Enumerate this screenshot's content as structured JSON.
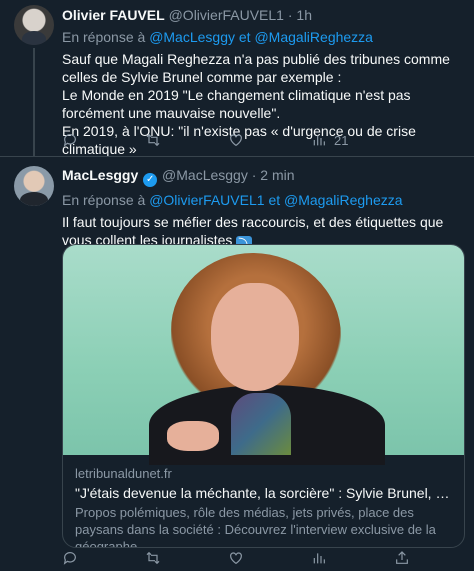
{
  "tweets": [
    {
      "name": "Olivier FAUVEL",
      "handle": "@OlivierFAUVEL1",
      "time": "1h",
      "reply_prefix": "En réponse à",
      "reply_to": [
        "@MacLesggy",
        "@MagaliReghezza"
      ],
      "reply_joiner": "et",
      "lines": [
        "Sauf que Magali Reghezza n'a pas publié des tribunes comme celles de Sylvie Brunel comme par exemple :",
        "Le Monde en 2019 \"Le changement climatique n'est pas forcément une mauvaise nouvelle\".",
        "En 2019, à l'ONU: \"il n'existe pas « d'urgence ou de crise climatique »"
      ],
      "actions": {
        "reply": "",
        "retweet": "",
        "like": "",
        "views": "21"
      }
    },
    {
      "name": "MacLesggy",
      "handle": "@MacLesggy",
      "time": "2 min",
      "verified": true,
      "reply_prefix": "En réponse à",
      "reply_to": [
        "@OlivierFAUVEL1",
        "@MagaliReghezza"
      ],
      "reply_joiner": "et",
      "text": "Il faut toujours se méfier des raccourcis, et des étiquettes que vous collent les journalistes",
      "emoji": "⤵",
      "card": {
        "domain": "letribunaldunet.fr",
        "title": "\"J'étais devenue la méchante, la sorcière\" : Sylvie Brunel, professeur...",
        "description": "Propos polémiques, rôle des médias, jets privés, place des paysans dans la société : Découvrez l'interview exclusive de la géographe."
      },
      "actions": {
        "reply": "",
        "retweet": "",
        "like": "",
        "views": ""
      }
    }
  ],
  "colors": {
    "background": "#15202b",
    "accent": "#1d9bf0",
    "muted": "#8b98a5",
    "divider": "#38444d"
  }
}
